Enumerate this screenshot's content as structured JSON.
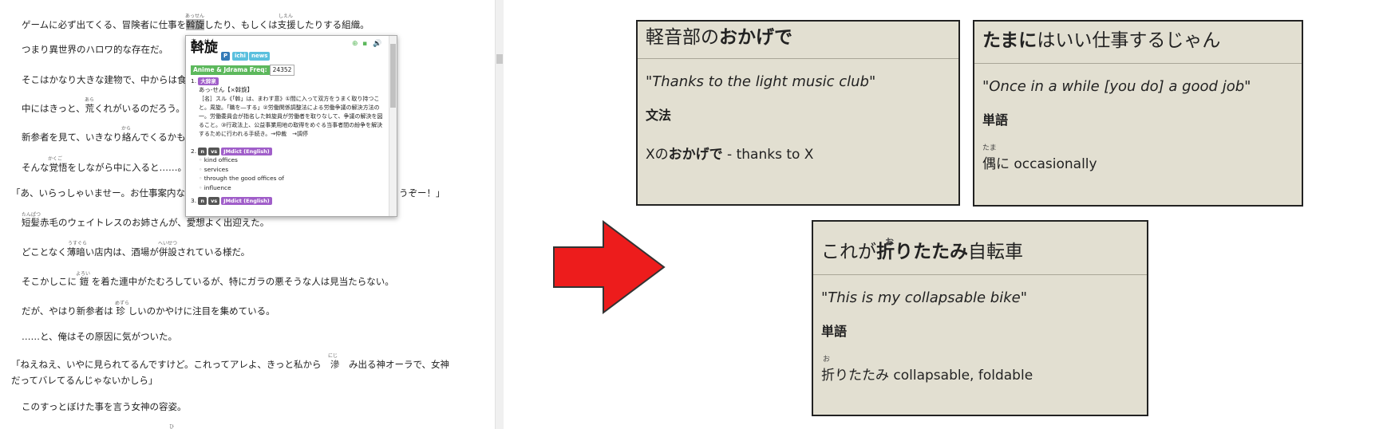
{
  "reader": {
    "lines": [
      "ゲームに必ず出てくる、冒険者に仕事を斡旋したり、もしくは支援したりする組織。",
      "つまり異世界のハロワ的な存在だ。",
      "そこはかなり大きな建物で、中からは食",
      "中にはきっと、荒くれがいるのだろう。",
      "新参者を見て、いきなり絡んでくるかも",
      "そんな覚悟をしながら中に入ると……。",
      "「あ、いらっしゃいませー。お仕事案内な",
      "うぞー！」",
      "短髪赤毛のウェイトレスのお姉さんが、愛想よく出迎えた。",
      "どことなく薄暗い店内は、酒場が併設されている様だ。",
      "そこかしこに 鎧 を着た連中がたむろしているが、特にガラの悪そうな人は見当たらない。",
      "だが、やはり新参者は 珍 しいのかやけに注目を集めている。",
      "……と、俺はその原因に気がついた。",
      "「ねえねえ、いやに見られてるんですけど。これってアレよ、きっと私から　滲　み出る神オーラで、女神",
      "だってバレてるんじゃないかしら」",
      "このすっとぼけた事を言う女神の容姿。"
    ],
    "furigana": {
      "assen": "あっせん",
      "shien": "しえん",
      "ara": "あら",
      "kara": "から",
      "kakugo": "かくご",
      "tanpatsu": "たんぱつ",
      "usugura": "うすぐら",
      "heisetsu": "へいせつ",
      "yoroi": "よろい",
      "mezura": "めずら",
      "niji": "にじ",
      "hi": "ひ"
    }
  },
  "popup": {
    "reading": "あっせん",
    "headword": "斡旋",
    "tags": [
      "P",
      "ichi",
      "news"
    ],
    "freq_label": "Anime & Jdrama Freq:",
    "freq_value": "24352",
    "def1_num": "1.",
    "def1_dict": "大辞泉",
    "def1_head": "あっ‐せん【×斡旋】",
    "def1_text": "［名］スル《「斡」は、まわす意》①間に入って双方をうまく取り持つこと。周旋。「職を―する」②労働関係調整法による労働争議の解決方法の一。労働委員会が指名した斡旋員が労働者を取りなして、争議の解決を図ること。③行政法上、公益事業用地の取得をめぐる当事者間の紛争を解決するために行われる手続き。→仲裁　→調停",
    "def2_num": "2.",
    "def2_tags": [
      "n",
      "vs"
    ],
    "def2_dict": "JMdict (English)",
    "def2_glosses": [
      "kind offices",
      "services",
      "through the good offices of",
      "influence"
    ],
    "def3_num": "3.",
    "def3_tags": [
      "n",
      "vs"
    ],
    "def3_dict": "JMdict (English)"
  },
  "cards": [
    {
      "front_plain": "軽音部の",
      "front_bold": "おかげで",
      "english": "\"Thanks to the light music club\"",
      "section": "文法",
      "body_pre": "Xの",
      "body_bold": "おかげで",
      "body_post": " - thanks to X"
    },
    {
      "front_bold": "たまに",
      "front_plain": "はいい仕事するじゃん",
      "english": "\"Once in a while [you do] a good job\"",
      "section": "単語",
      "body_furi": "たま",
      "body_word": "偶に",
      "body_gloss": " occasionally"
    },
    {
      "front_furi": "お",
      "front_pre": "これが",
      "front_bold": "折りたたみ",
      "front_post": "自転車",
      "english": "\"This is my collapsable bike\"",
      "section": "単語",
      "body_furi": "お",
      "body_word": "折りたたみ",
      "body_gloss": " collapsable, foldable"
    }
  ],
  "colors": {
    "card_bg": "#e2dfd1",
    "arrow": "#ed1c1c",
    "freq_tag": "#5cb85c",
    "dict_tag": "#a05ec9",
    "ptag_p": "#337ab7",
    "ptag_ichi": "#5bc0de",
    "ptag_news": "#5bc0de"
  }
}
